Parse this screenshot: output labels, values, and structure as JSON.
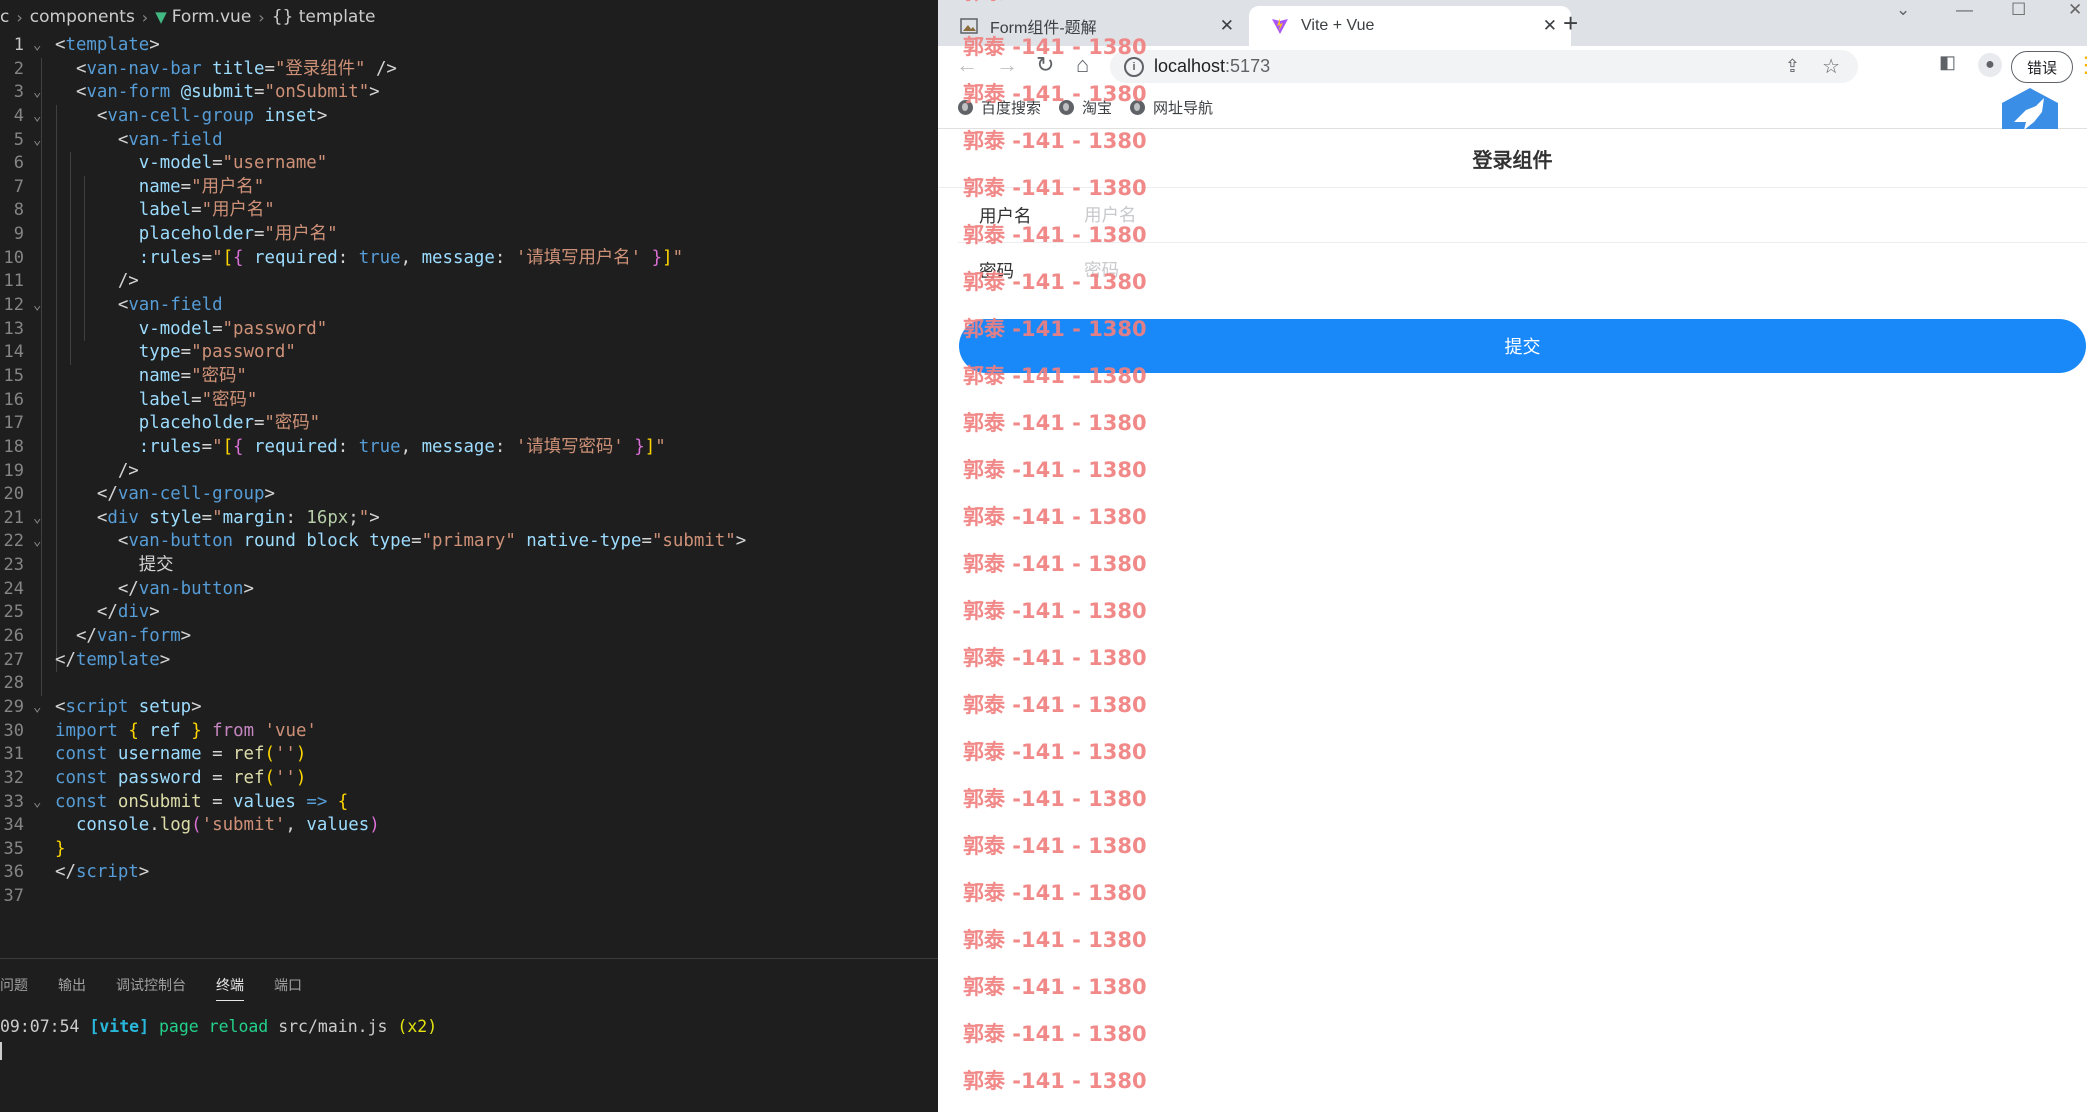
{
  "editor": {
    "breadcrumb": [
      "c",
      "components",
      "Form.vue",
      "{} template"
    ],
    "code_lines": [
      {
        "n": "1",
        "fold": "⌄"
      },
      {
        "n": "2"
      },
      {
        "n": "3",
        "fold": "⌄"
      },
      {
        "n": "4",
        "fold": "⌄"
      },
      {
        "n": "5",
        "fold": "⌄"
      },
      {
        "n": "6"
      },
      {
        "n": "7"
      },
      {
        "n": "8"
      },
      {
        "n": "9"
      },
      {
        "n": "10"
      },
      {
        "n": "11"
      },
      {
        "n": "12",
        "fold": "⌄"
      },
      {
        "n": "13"
      },
      {
        "n": "14"
      },
      {
        "n": "15"
      },
      {
        "n": "16"
      },
      {
        "n": "17"
      },
      {
        "n": "18"
      },
      {
        "n": "19"
      },
      {
        "n": "20"
      },
      {
        "n": "21",
        "fold": "⌄"
      },
      {
        "n": "22",
        "fold": "⌄"
      },
      {
        "n": "23"
      },
      {
        "n": "24"
      },
      {
        "n": "25"
      },
      {
        "n": "26"
      },
      {
        "n": "27"
      },
      {
        "n": "28"
      },
      {
        "n": "29",
        "fold": "⌄"
      },
      {
        "n": "30"
      },
      {
        "n": "31"
      },
      {
        "n": "32"
      },
      {
        "n": "33",
        "fold": "⌄"
      },
      {
        "n": "34"
      },
      {
        "n": "35"
      },
      {
        "n": "36"
      },
      {
        "n": "37"
      }
    ],
    "panel_tabs": [
      "问题",
      "输出",
      "调试控制台",
      "终端",
      "端口"
    ],
    "active_panel_tab": "终端",
    "terminal": {
      "time": "09:07:54",
      "tag": "[vite]",
      "msg": "page reload",
      "file": "src/main.js",
      "count": "(x2)"
    }
  },
  "browser": {
    "tabs": [
      {
        "title": "Form组件-题解",
        "active": false
      },
      {
        "title": "Vite + Vue",
        "active": true
      }
    ],
    "url_host": "localhost",
    "url_port": ":5173",
    "error_button": "错误",
    "bookmarks": [
      "百度搜索",
      "淘宝",
      "网址导航"
    ],
    "page": {
      "nav_title": "登录组件",
      "fields": [
        {
          "label": "用户名",
          "placeholder": "用户名",
          "value": ""
        },
        {
          "label": "密码",
          "placeholder": "密码",
          "value": ""
        }
      ],
      "submit_label": "提交"
    },
    "watermark": "郭泰 -141 - 1380",
    "watermark_color": "#f08080"
  },
  "colors": {
    "primary": "#1989fa",
    "editor_bg": "#1e1e1e",
    "tabstrip": "#dee1e6"
  }
}
